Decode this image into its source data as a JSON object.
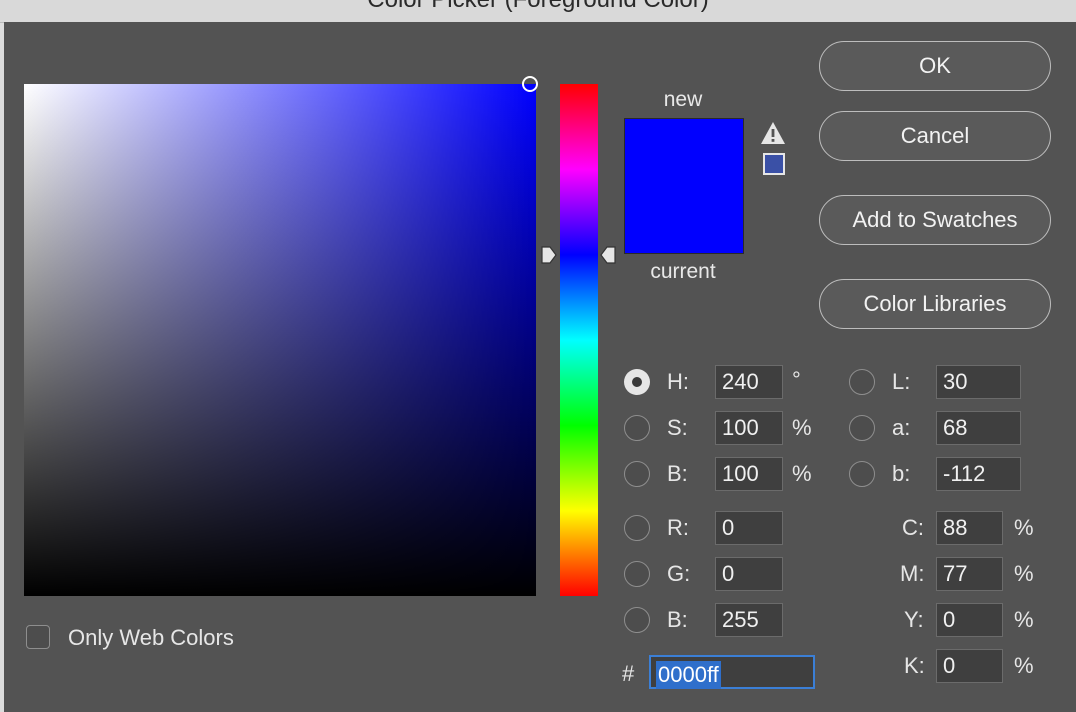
{
  "window": {
    "title": "Color Picker (Foreground Color)"
  },
  "preview": {
    "new_label": "new",
    "current_label": "current",
    "new_color": "#0000ff",
    "current_color": "#0000ff",
    "gamut_color": "#3a50a6"
  },
  "picker": {
    "hue": 240,
    "base_color": "#0000ff"
  },
  "buttons": {
    "ok": "OK",
    "cancel": "Cancel",
    "add_swatches": "Add to Swatches",
    "color_libraries": "Color Libraries"
  },
  "hsb": {
    "h": {
      "label": "H:",
      "value": "240",
      "unit": "°"
    },
    "s": {
      "label": "S:",
      "value": "100",
      "unit": "%"
    },
    "b": {
      "label": "B:",
      "value": "100",
      "unit": "%"
    }
  },
  "rgb": {
    "r": {
      "label": "R:",
      "value": "0"
    },
    "g": {
      "label": "G:",
      "value": "0"
    },
    "b": {
      "label": "B:",
      "value": "255"
    }
  },
  "lab": {
    "l": {
      "label": "L:",
      "value": "30"
    },
    "a": {
      "label": "a:",
      "value": "68"
    },
    "b": {
      "label": "b:",
      "value": "-112"
    }
  },
  "cmyk": {
    "c": {
      "label": "C:",
      "value": "88",
      "unit": "%"
    },
    "m": {
      "label": "M:",
      "value": "77",
      "unit": "%"
    },
    "y": {
      "label": "Y:",
      "value": "0",
      "unit": "%"
    },
    "k": {
      "label": "K:",
      "value": "0",
      "unit": "%"
    }
  },
  "hex": {
    "label": "#",
    "value": "0000ff"
  },
  "web_colors": {
    "label": "Only Web Colors",
    "checked": false
  }
}
